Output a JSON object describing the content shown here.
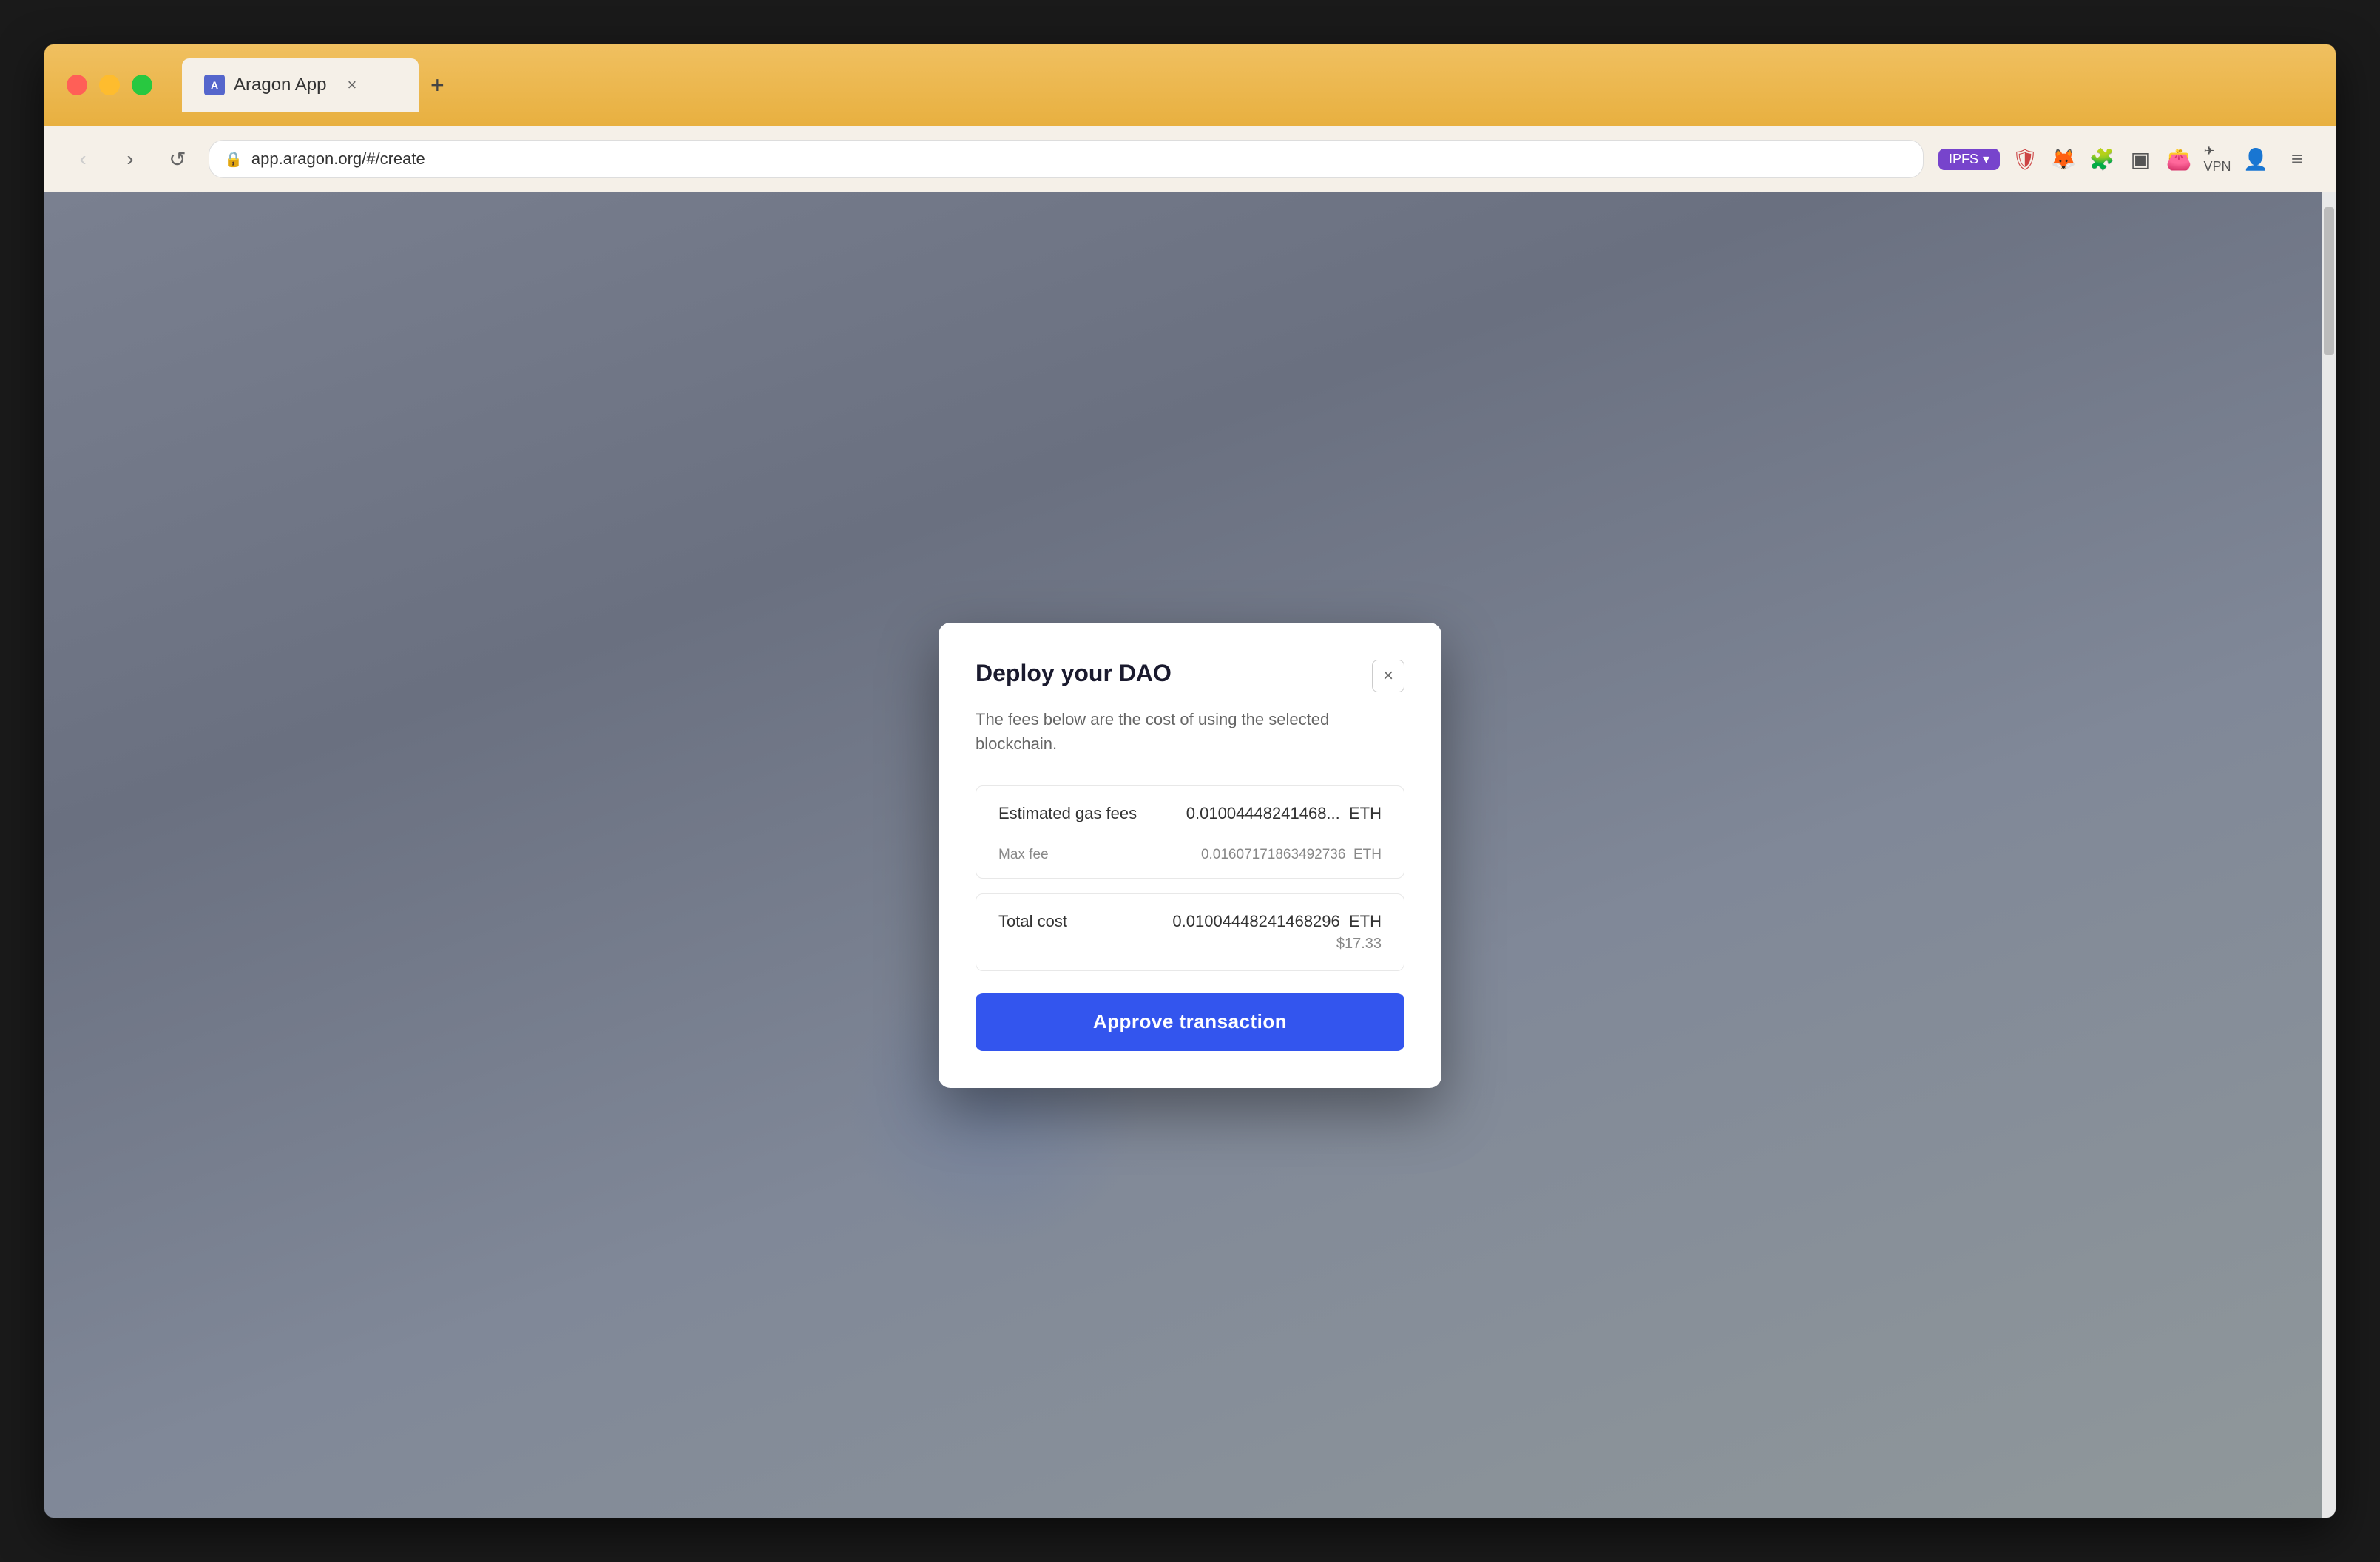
{
  "browser": {
    "tab": {
      "favicon_text": "A",
      "title": "Aragon App",
      "close_label": "×",
      "new_tab_label": "+"
    },
    "nav": {
      "back_icon": "‹",
      "forward_icon": "›",
      "refresh_icon": "↺",
      "address": "app.aragon.org/#/create",
      "lock_icon": "🔒"
    },
    "extensions": {
      "ipfs_label": "IPFS",
      "dropdown_icon": "▾",
      "menu_icon": "≡"
    }
  },
  "modal": {
    "title": "Deploy your DAO",
    "subtitle": "The fees below are the cost of using the selected blockchain.",
    "close_icon": "×",
    "estimated_gas": {
      "label": "Estimated gas fees",
      "primary_value": "0.01004448241468...",
      "primary_currency": "ETH",
      "max_fee_label": "Max fee",
      "max_fee_value": "0.01607171863492736",
      "max_fee_currency": "ETH"
    },
    "total_cost": {
      "label": "Total cost",
      "eth_value": "0.01004448241468296",
      "eth_currency": "ETH",
      "usd_value": "$17.33"
    },
    "approve_button": "Approve transaction"
  }
}
